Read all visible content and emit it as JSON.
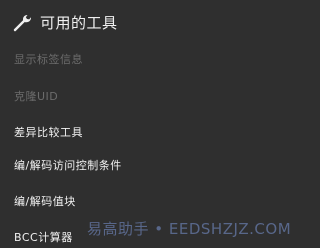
{
  "header": {
    "title": "可用的工具"
  },
  "items": [
    {
      "label": "显示标签信息",
      "enabled": false
    },
    {
      "label": "克隆UID",
      "enabled": false
    },
    {
      "label": "差异比较工具",
      "enabled": true
    },
    {
      "label": "编/解码访问控制条件",
      "enabled": true
    },
    {
      "label": "编/解码值块",
      "enabled": true
    },
    {
      "label": "BCC计算器",
      "enabled": true
    }
  ],
  "watermark": "易高助手 • EEDSHZJZ.COM"
}
